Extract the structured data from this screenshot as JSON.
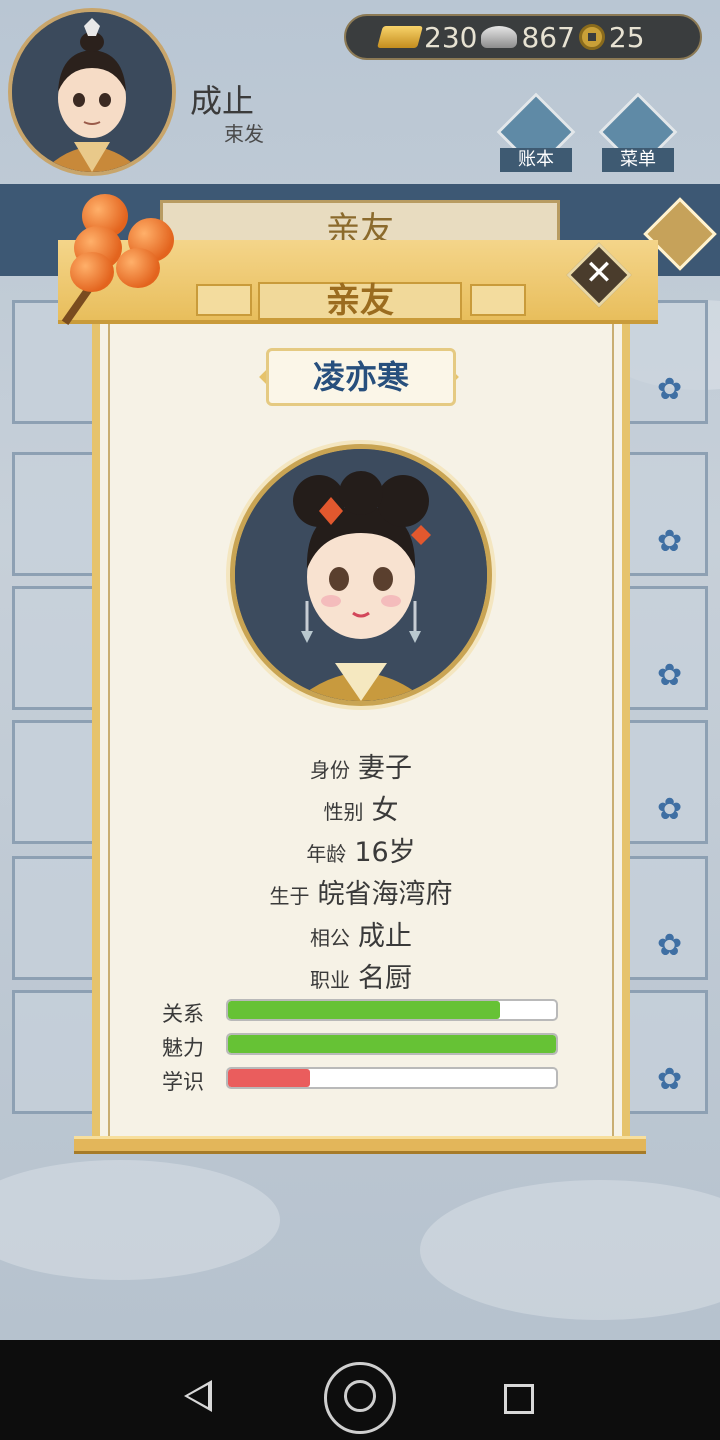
{
  "header": {
    "player_name": "成止",
    "player_rank": "束发",
    "resources": [
      {
        "icon": "gold-ingot-icon",
        "value": "230"
      },
      {
        "icon": "silver-ingot-icon",
        "value": "867"
      },
      {
        "icon": "copper-coin-icon",
        "value": "25"
      }
    ],
    "ledger_label": "账本",
    "menu_label": "菜单"
  },
  "background_panel": {
    "tab_title": "亲友"
  },
  "dialog": {
    "title": "亲友",
    "close_glyph": "✕",
    "person_name": "凌亦寒",
    "info": [
      {
        "label": "身份",
        "value": "妻子"
      },
      {
        "label": "性别",
        "value": "女"
      },
      {
        "label": "年龄",
        "value": "16岁"
      },
      {
        "label": "生于",
        "value": "皖省海湾府"
      },
      {
        "label": "相公",
        "value": "成止"
      },
      {
        "label": "职业",
        "value": "名厨"
      }
    ],
    "stats": [
      {
        "label": "关系",
        "percent": 83,
        "color": "#66c235"
      },
      {
        "label": "魅力",
        "percent": 100,
        "color": "#66c235"
      },
      {
        "label": "学识",
        "percent": 25,
        "color": "#ea5d5d"
      }
    ]
  },
  "nav": {
    "back_icon": "back-triangle-icon",
    "home_icon": "home-circle-icon",
    "recent_icon": "recent-square-icon"
  }
}
